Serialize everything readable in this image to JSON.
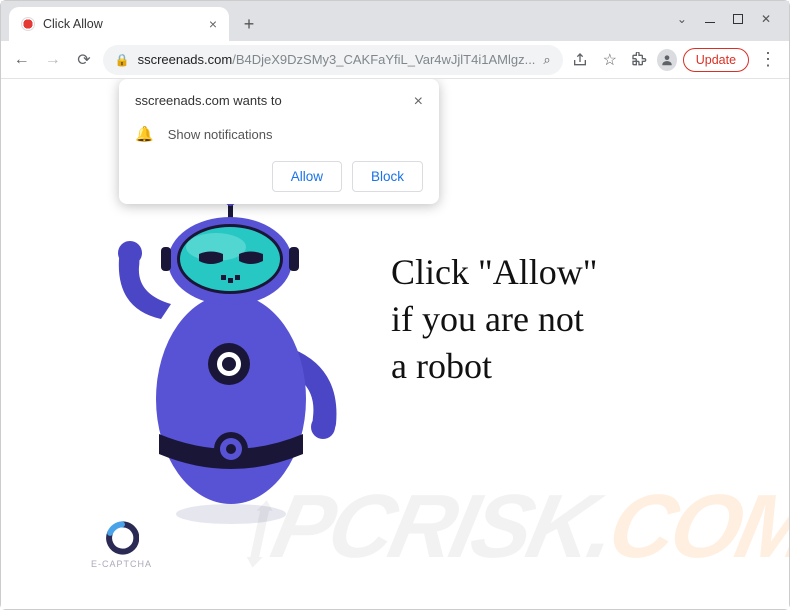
{
  "window": {
    "tab_title": "Click Allow",
    "update_label": "Update"
  },
  "address": {
    "domain": "sscreenads.com",
    "path": "/B4DjeX9DzSMy3_CAKFaYfiL_Var4wJjlT4i1AMlgz..."
  },
  "permission": {
    "origin": "sscreenads.com wants to",
    "notification_label": "Show notifications",
    "allow_label": "Allow",
    "block_label": "Block"
  },
  "page": {
    "line1": "Click \"Allow\"",
    "line2": "if you are not",
    "line3": "a robot"
  },
  "captcha": {
    "label": "E-CAPTCHA"
  },
  "watermark": {
    "text_gray": "PCRISK.",
    "text_orange": "COM"
  }
}
